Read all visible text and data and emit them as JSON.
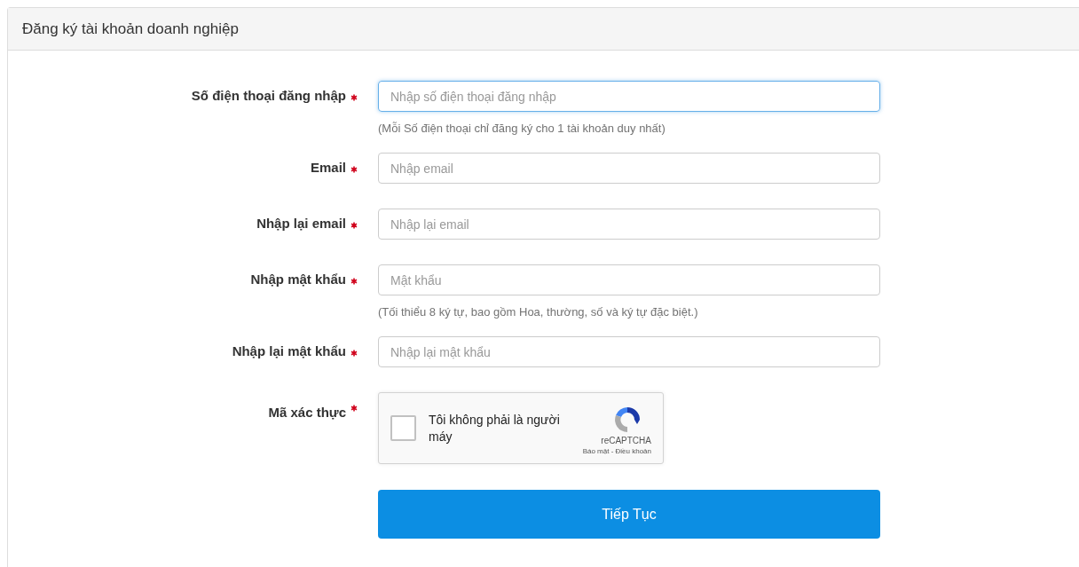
{
  "panel": {
    "title": "Đăng ký tài khoản doanh nghiệp"
  },
  "fields": [
    {
      "label": "Số điện thoại đăng nhập",
      "required": true,
      "placeholder": "Nhập số điện thoại đăng nhập",
      "focused": true,
      "hint": "(Mỗi Số điện thoại chỉ đăng ký cho 1 tài khoản duy nhất)"
    },
    {
      "label": "Email",
      "required": true,
      "placeholder": "Nhập email",
      "focused": false
    },
    {
      "label": "Nhập lại email",
      "required": true,
      "placeholder": "Nhập lại email",
      "focused": false
    },
    {
      "label": "Nhập mật khẩu",
      "required": true,
      "placeholder": "Mật khẩu",
      "focused": false,
      "hint": "(Tối thiểu 8 ký tự, bao gồm Hoa, thường, số và ký tự đặc biệt.)"
    },
    {
      "label": "Nhập lại mật khẩu",
      "required": true,
      "placeholder": "Nhập lại mật khẩu",
      "focused": false
    }
  ],
  "captcha": {
    "label": "Mã xác thực",
    "required": true,
    "checkbox_label": "Tôi không phải là người máy",
    "checked": false,
    "brand": "reCAPTCHA",
    "links": "Báo mật - Điều khoản"
  },
  "submit_button": "Tiếp Tục"
}
